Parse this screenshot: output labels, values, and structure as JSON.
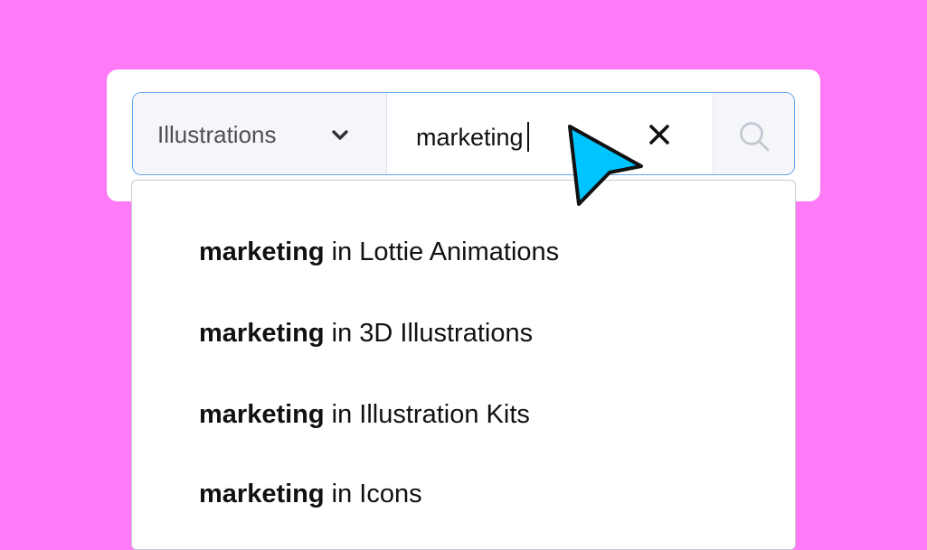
{
  "search": {
    "category": "Illustrations",
    "query": "marketing",
    "icons": {
      "category_toggle": "chevron-down-icon",
      "clear": "close-icon",
      "submit": "search-icon",
      "pointer": "mouse-pointer-icon"
    }
  },
  "suggestions": [
    {
      "term": "marketing",
      "context": "in Lottie Animations"
    },
    {
      "term": "marketing",
      "context": "in 3D Illustrations"
    },
    {
      "term": "marketing",
      "context": "in Illustration Kits"
    },
    {
      "term": "marketing",
      "context": "in Icons"
    }
  ],
  "colors": {
    "background": "#ff7af7",
    "search_border": "#62a7ef",
    "pointer_fill": "#00c4ff"
  }
}
